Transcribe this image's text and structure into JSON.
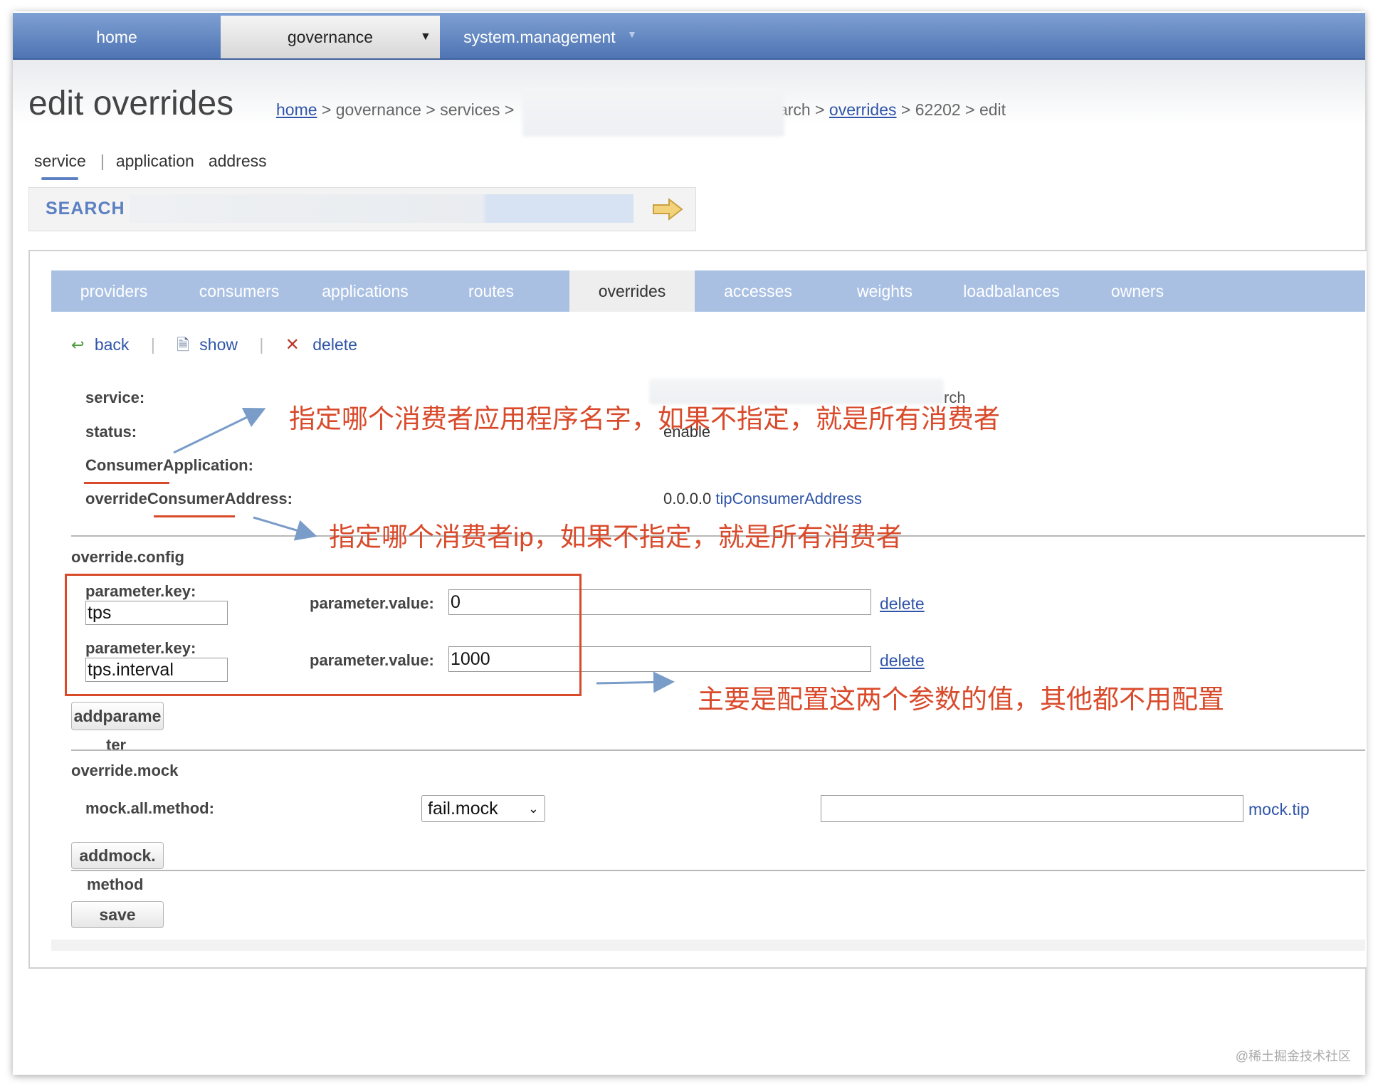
{
  "topnav": {
    "tabs": [
      {
        "label": "home"
      },
      {
        "label": "governance"
      },
      {
        "label": "system.management"
      }
    ]
  },
  "page": {
    "title": "edit overrides"
  },
  "breadcrumb": {
    "home": "home",
    "governance": "governance",
    "services": "services",
    "search_partial": "earch",
    "overrides": "overrides",
    "id": "62202",
    "edit": "edit",
    "sep": ">"
  },
  "search_type_tabs": [
    "service",
    "application",
    "address"
  ],
  "search": {
    "label": "SEARCH",
    "value": ""
  },
  "tabs": [
    "providers",
    "consumers",
    "applications",
    "routes",
    "overrides",
    "accesses",
    "weights",
    "loadbalances",
    "owners"
  ],
  "actions": {
    "back": "back",
    "show": "show",
    "delete": "delete"
  },
  "details": {
    "service_label": "service:",
    "service_value_partial": "rch",
    "status_label": "status:",
    "status_value": "enable",
    "consumer_app_label": "ConsumerApplication:",
    "override_addr_label": "overrideConsumerAddress:",
    "override_addr_value": "0.0.0.0",
    "override_addr_tip": "tipConsumerAddress"
  },
  "override_config": {
    "heading": "override.config",
    "key_label": "parameter.key:",
    "value_label": "parameter.value:",
    "delete_label": "delete",
    "rows": [
      {
        "key": "tps",
        "value": "0"
      },
      {
        "key": "tps.interval",
        "value": "1000"
      }
    ],
    "add_button_line1": "addparame",
    "add_button_line2": "ter"
  },
  "override_mock": {
    "heading": "override.mock",
    "method_label": "mock.all.method:",
    "selected": "fail.mock",
    "input_value": "",
    "tip": "mock.tip",
    "add_button_line1": "addmock.",
    "add_button_line2": "method"
  },
  "save_label": "save",
  "annotations": {
    "consumer_app_note": "指定哪个消费者应用程序名字，如果不指定，就是所有消费者",
    "consumer_ip_note": "指定哪个消费者ip，如果不指定，就是所有消费者",
    "params_note": "主要是配置这两个参数的值，其他都不用配置"
  },
  "watermark": "@稀土掘金技术社区",
  "colors": {
    "nav_blue": "#5c80c2",
    "tab_blue": "#aac0e3",
    "link": "#2f54a8",
    "annotation_red": "#d94a2b"
  }
}
